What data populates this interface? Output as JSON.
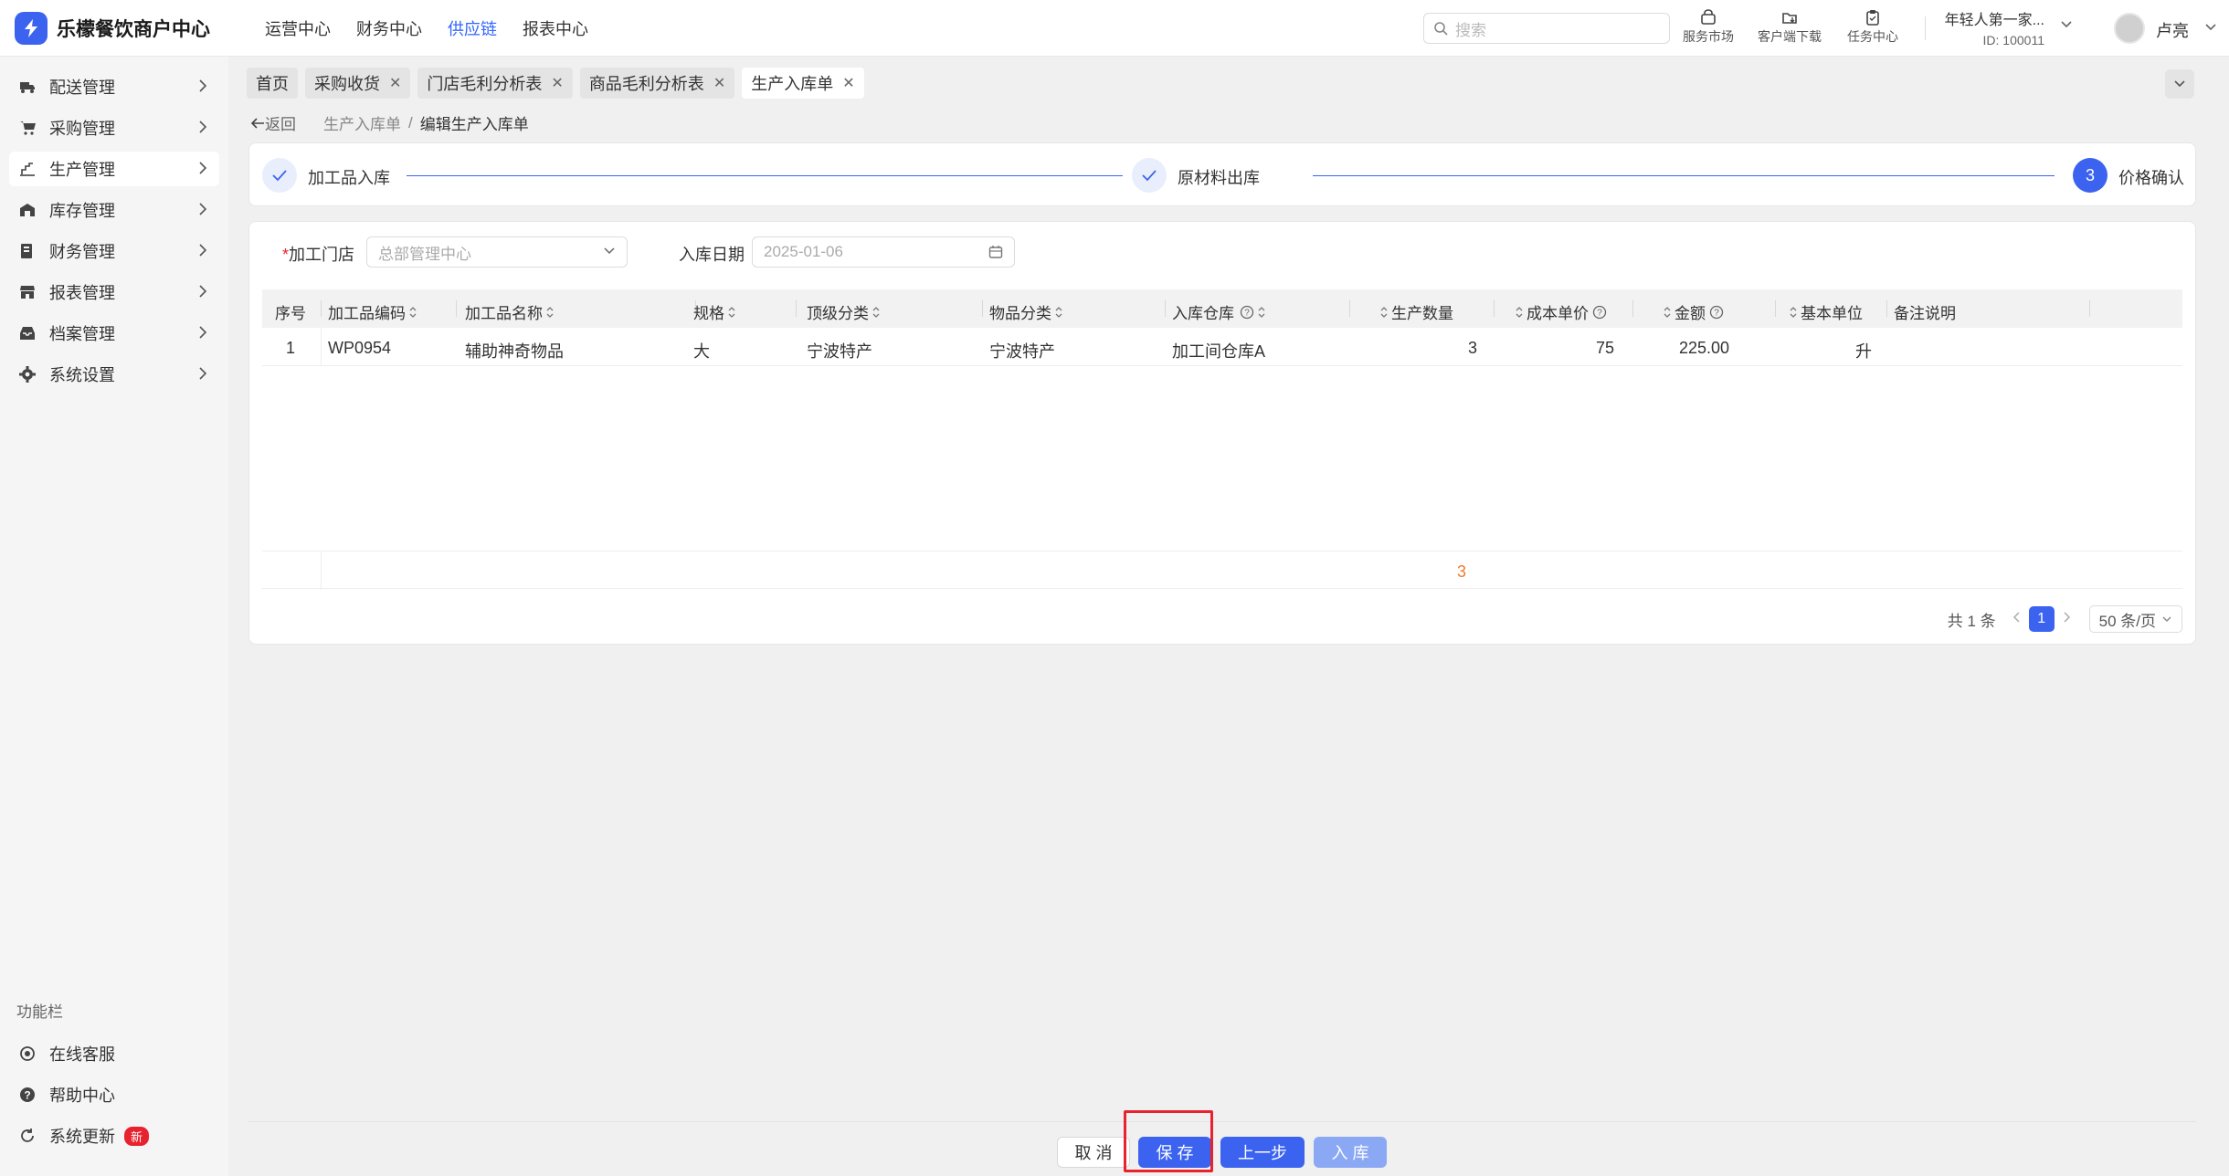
{
  "app": {
    "title": "乐檬餐饮商户中心"
  },
  "topnav": [
    "运营中心",
    "财务中心",
    "供应链",
    "报表中心"
  ],
  "search": {
    "placeholder": "搜索"
  },
  "tools": [
    "服务市场",
    "客户端下载",
    "任务中心"
  ],
  "org": {
    "name": "年轻人第一家...",
    "id": "ID: 100011"
  },
  "user": {
    "name": "卢亮"
  },
  "sidebar": {
    "items": [
      "配送管理",
      "采购管理",
      "生产管理",
      "库存管理",
      "财务管理",
      "报表管理",
      "档案管理",
      "系统设置"
    ],
    "func_title": "功能栏",
    "func_items": [
      "在线客服",
      "帮助中心",
      "系统更新"
    ],
    "new_badge": "新"
  },
  "tabs": [
    "首页",
    "采购收货",
    "门店毛利分析表",
    "商品毛利分析表",
    "生产入库单"
  ],
  "breadcrumb": {
    "back": "返回",
    "parent": "生产入库单",
    "sep": "/",
    "current": "编辑生产入库单"
  },
  "steps": [
    {
      "label": "加工品入库",
      "status": "done"
    },
    {
      "label": "原材料出库",
      "status": "done"
    },
    {
      "label": "价格确认",
      "status": "current",
      "num": "3"
    }
  ],
  "form": {
    "store_label": "加工门店",
    "store_required": "*",
    "store_value": "总部管理中心",
    "date_label": "入库日期",
    "date_value": "2025-01-06"
  },
  "table": {
    "headers": [
      "序号",
      "加工品编码",
      "加工品名称",
      "规格",
      "顶级分类",
      "物品分类",
      "入库仓库",
      "生产数量",
      "成本单价",
      "金额",
      "基本单位",
      "备注说明"
    ],
    "rows": [
      {
        "idx": "1",
        "code": "WP0954",
        "name": "辅助神奇物品",
        "spec": "大",
        "top_cat": "宁波特产",
        "cat": "宁波特产",
        "warehouse": "加工间仓库A",
        "qty": "3",
        "price": "75",
        "amount": "225.00",
        "unit": "升",
        "note": ""
      }
    ],
    "total_qty": "3"
  },
  "pager": {
    "total": "共 1 条",
    "page": "1",
    "size": "50 条/页"
  },
  "actions": {
    "cancel": "取 消",
    "save": "保 存",
    "prev": "上一步",
    "submit": "入 库"
  },
  "colors": {
    "accent": "#3b63f0",
    "highlight": "#e8222e",
    "sum": "#f07b2a"
  }
}
